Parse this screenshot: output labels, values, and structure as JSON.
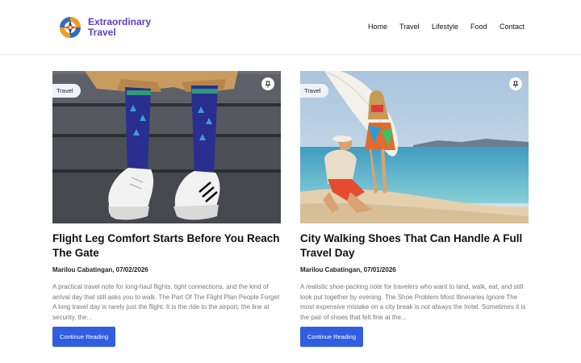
{
  "site": {
    "name_line1": "Extraordinary",
    "name_line2": "Travel"
  },
  "nav": {
    "items": [
      "Home",
      "Travel",
      "Lifestyle",
      "Food",
      "Contact"
    ]
  },
  "posts": [
    {
      "category": "Travel",
      "title": "Flight Leg Comfort Starts Before You Reach The Gate",
      "meta": "Marilou Cabatingan, 07/02/2026",
      "excerpt": "A practical travel note for long-haul flights, tight connections, and the kind of arrival day that still asks you to walk. The Part Of The Flight Plan People Forget A long travel day is rarely just the flight. It is the ride to the airport, the line at security, the...",
      "cta": "Continue Reading",
      "image": "socks-sneakers-photo",
      "pin_icon": "pin-icon"
    },
    {
      "category": "Travel",
      "title": "City Walking Shoes That Can Handle A Full Travel Day",
      "meta": "Marilou Cabatingan, 07/01/2026",
      "excerpt": "A realistic shoe-packing note for travelers who want to land, walk, eat, and still look put together by evening. The Shoe Problem Most Itineraries Ignore The most expensive mistake on a city break is not always the hotel. Sometimes it is the pair of shoes that felt fine at the...",
      "cta": "Continue Reading",
      "image": "beach-couple-surfboard-photo",
      "pin_icon": "pin-icon"
    }
  ],
  "colors": {
    "brand": "#5b3fc4",
    "button": "#2f5fe0"
  }
}
